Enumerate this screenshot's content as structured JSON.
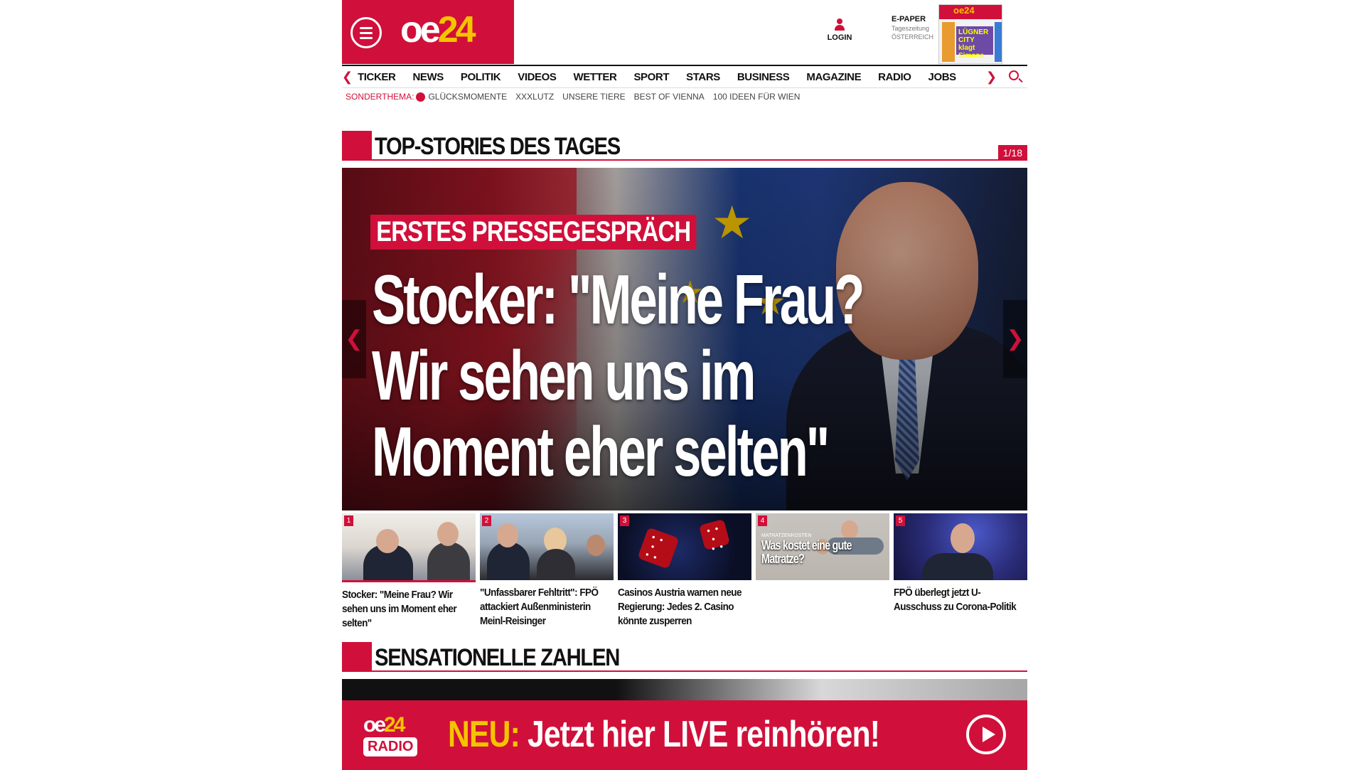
{
  "header": {
    "logo_main": "oe",
    "logo_num": "24",
    "login_label": "LOGIN",
    "epaper_title": "E-PAPER",
    "epaper_sub1": "Tageszeitung",
    "epaper_sub2": "ÖSTERREICH",
    "epaper_cover_headline": "LÜGNER CITY klagt Simone"
  },
  "nav": {
    "items": [
      "TICKER",
      "NEWS",
      "POLITIK",
      "VIDEOS",
      "WETTER",
      "SPORT",
      "STARS",
      "BUSINESS",
      "MAGAZINE",
      "RADIO",
      "JOBS"
    ]
  },
  "subnav": {
    "lead": "SONDERTHEMA:",
    "items": [
      "GLÜCKSMOMENTE",
      "XXXLUTZ",
      "UNSERE TIERE",
      "BEST OF VIENNA",
      "100 IDEEN FÜR WIEN"
    ]
  },
  "top_stories": {
    "title": "TOP-STORIES DES TAGES",
    "counter": "1/18",
    "hero": {
      "kicker": "ERSTES PRESSEGESPRÄCH",
      "headline": "Stocker: \"Meine Frau? Wir sehen uns im Moment eher selten\""
    },
    "items": [
      {
        "num": "1",
        "title": "Stocker: \"Meine Frau? Wir sehen uns im Moment eher selten\""
      },
      {
        "num": "2",
        "title": "\"Unfassbarer Fehltritt\": FPÖ attackiert Außenministerin Meinl-Reisinger"
      },
      {
        "num": "3",
        "title": "Casinos Austria warnen neue Regierung: Jedes 2. Casino könnte zusperren"
      },
      {
        "num": "4",
        "title": "",
        "overlay_small": "MATRATZENKOSTEN",
        "overlay": "Was kostet eine gute Matratze?"
      },
      {
        "num": "5",
        "title": "FPÖ überlegt jetzt U-Ausschuss zu Corona-Politik"
      }
    ]
  },
  "sensationelle": {
    "title": "SENSATIONELLE ZAHLEN"
  },
  "radio": {
    "logo_main": "oe",
    "logo_num": "24",
    "logo_sub": "RADIO",
    "neu": "NEU:",
    "cta": "Jetzt hier LIVE reinhören!"
  },
  "colors": {
    "brand_red": "#d0103a",
    "brand_yellow": "#f5c400"
  }
}
